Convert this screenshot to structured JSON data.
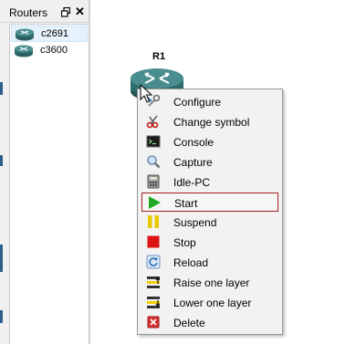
{
  "dock": {
    "title": "Routers",
    "items": [
      {
        "label": "c2691",
        "selected": true
      },
      {
        "label": "c3600",
        "selected": false
      }
    ]
  },
  "canvas": {
    "node": {
      "label": "R1"
    }
  },
  "menu": {
    "items": [
      {
        "label": "Configure",
        "icon": "configure-icon"
      },
      {
        "label": "Change symbol",
        "icon": "change-symbol-icon"
      },
      {
        "label": "Console",
        "icon": "console-icon"
      },
      {
        "label": "Capture",
        "icon": "capture-icon"
      },
      {
        "label": "Idle-PC",
        "icon": "idle-pc-icon"
      },
      {
        "label": "Start",
        "icon": "start-icon",
        "highlighted": true
      },
      {
        "label": "Suspend",
        "icon": "suspend-icon"
      },
      {
        "label": "Stop",
        "icon": "stop-icon"
      },
      {
        "label": "Reload",
        "icon": "reload-icon"
      },
      {
        "label": "Raise one layer",
        "icon": "raise-layer-icon"
      },
      {
        "label": "Lower one layer",
        "icon": "lower-layer-icon"
      },
      {
        "label": "Delete",
        "icon": "delete-icon"
      }
    ]
  },
  "colors": {
    "router_teal": "#2f6b6c",
    "highlight_border": "#a51f1f",
    "start_green": "#22aa22",
    "stop_red": "#dd1111",
    "suspend_yellow": "#e8c800"
  }
}
